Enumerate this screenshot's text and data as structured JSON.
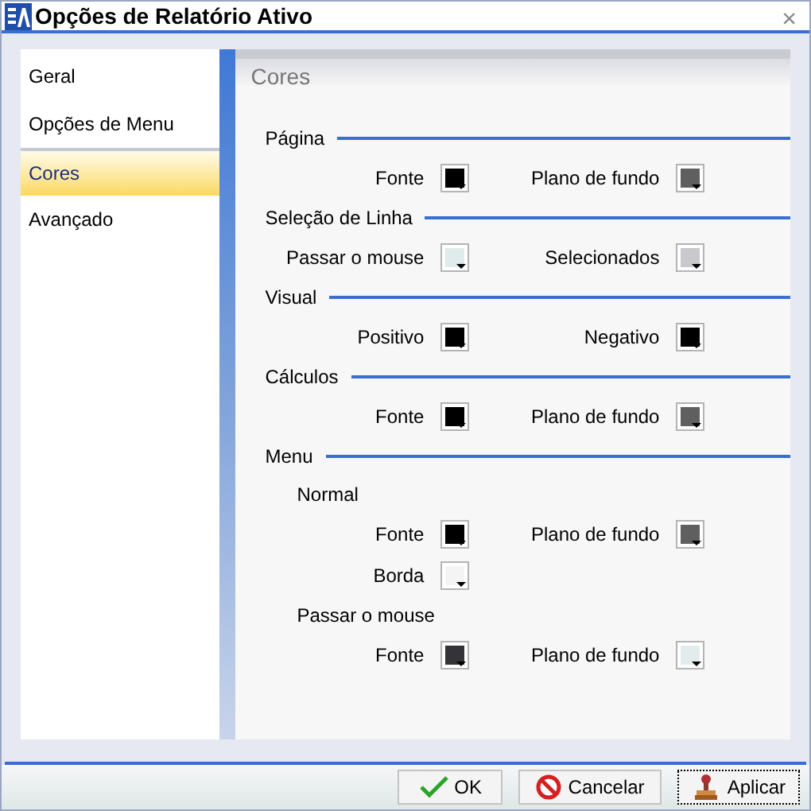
{
  "window": {
    "title": "Opções de Relatório Ativo",
    "close": "×"
  },
  "sidebar": {
    "items": [
      {
        "label": "Geral",
        "selected": false
      },
      {
        "label": "Opções de Menu",
        "selected": false
      },
      {
        "label": "Cores",
        "selected": true
      },
      {
        "label": "Avançado",
        "selected": false
      }
    ]
  },
  "panel": {
    "title": "Cores",
    "sections": [
      {
        "title": "Página",
        "items": [
          {
            "kind": "row",
            "fields": [
              {
                "label": "Fonte",
                "color": "#000000"
              },
              {
                "label": "Plano de fundo",
                "color": "#5f5f5f"
              }
            ]
          }
        ]
      },
      {
        "title": "Seleção de Linha",
        "items": [
          {
            "kind": "row",
            "fields": [
              {
                "label": "Passar o mouse",
                "color": "#dfeceb"
              },
              {
                "label": "Selecionados",
                "color": "#c8c8cd"
              }
            ]
          }
        ]
      },
      {
        "title": "Visual",
        "items": [
          {
            "kind": "row",
            "fields": [
              {
                "label": "Positivo",
                "color": "#000000"
              },
              {
                "label": "Negativo",
                "color": "#000000"
              }
            ]
          }
        ]
      },
      {
        "title": "Cálculos",
        "items": [
          {
            "kind": "row",
            "fields": [
              {
                "label": "Fonte",
                "color": "#000000"
              },
              {
                "label": "Plano de fundo",
                "color": "#5f5f5f"
              }
            ]
          }
        ]
      },
      {
        "title": "Menu",
        "items": [
          {
            "kind": "subheading",
            "label": "Normal"
          },
          {
            "kind": "row",
            "fields": [
              {
                "label": "Fonte",
                "color": "#000000"
              },
              {
                "label": "Plano de fundo",
                "color": "#5f5f5f"
              }
            ]
          },
          {
            "kind": "row",
            "fields": [
              {
                "label": "Borda",
                "color": "#f4f4f4"
              }
            ]
          },
          {
            "kind": "subheading",
            "label": "Passar o mouse"
          },
          {
            "kind": "row",
            "fields": [
              {
                "label": "Fonte",
                "color": "#333338"
              },
              {
                "label": "Plano de fundo",
                "color": "#e3ecec"
              }
            ]
          }
        ]
      }
    ]
  },
  "buttons": [
    {
      "kind": "ok",
      "label": "OK"
    },
    {
      "kind": "cancel",
      "label": "Cancelar"
    },
    {
      "kind": "apply",
      "label": "Aplicar"
    }
  ]
}
